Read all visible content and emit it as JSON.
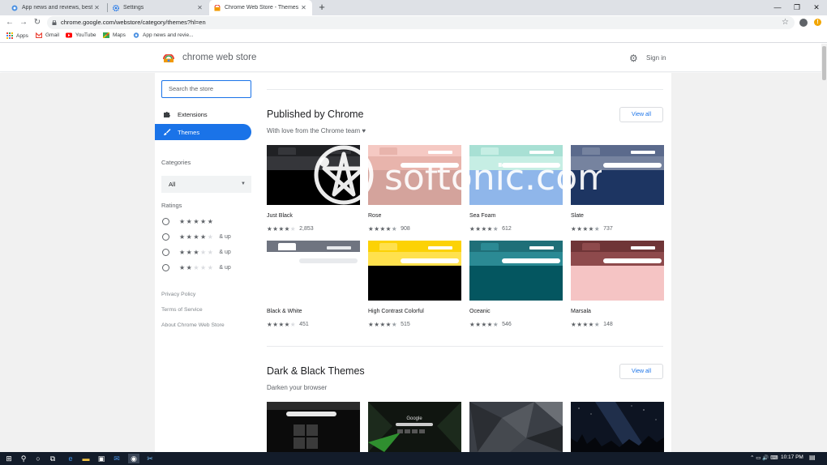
{
  "browser": {
    "tabs": [
      {
        "label": "App news and reviews, best soft",
        "active": false
      },
      {
        "label": "Settings",
        "active": false
      },
      {
        "label": "Chrome Web Store - Themes",
        "active": true
      }
    ],
    "url": "chrome.google.com/webstore/category/themes?hl=en",
    "bookmarks": [
      "Apps",
      "Gmail",
      "YouTube",
      "Maps",
      "App news and revie..."
    ]
  },
  "store": {
    "name": "chrome web store",
    "signin": "Sign in"
  },
  "sidebar": {
    "search_placeholder": "Search the store",
    "nav": [
      "Extensions",
      "Themes"
    ],
    "categories_label": "Categories",
    "category_value": "All",
    "ratings_label": "Ratings",
    "ratings": [
      {
        "stars": 5,
        "suffix": ""
      },
      {
        "stars": 4,
        "suffix": "& up"
      },
      {
        "stars": 3,
        "suffix": "& up"
      },
      {
        "stars": 2,
        "suffix": "& up"
      }
    ],
    "links": [
      "Privacy Policy",
      "Terms of Service",
      "About Chrome Web Store"
    ]
  },
  "sections": [
    {
      "title": "Published by Chrome",
      "subtitle": "With love from the Chrome team ♥",
      "view_all": "View all",
      "themes": [
        {
          "name": "Just Black",
          "rating": 4,
          "count": "2,853",
          "bar": "#202124",
          "tab": "#35363a",
          "body": "#000000",
          "omni": "#35363a"
        },
        {
          "name": "Rose",
          "rating": 4.5,
          "count": "908",
          "bar": "#f5c9c3",
          "tab": "#e8b4ac",
          "body": "#d4a39c",
          "omni": "#ffffff"
        },
        {
          "name": "Sea Foam",
          "rating": 4.5,
          "count": "612",
          "bar": "#a8e0d4",
          "tab": "#c6eee4",
          "body": "#8fb6ea",
          "omni": "#ffffff"
        },
        {
          "name": "Slate",
          "rating": 4.5,
          "count": "737",
          "bar": "#5b6a8c",
          "tab": "#76839f",
          "body": "#1d3562",
          "omni": "#ffffff"
        },
        {
          "name": "Black & White",
          "rating": 4,
          "count": "451",
          "bar": "#6f7480",
          "tab": "#ffffff",
          "body": "#ffffff",
          "omni": "#e8eaed"
        },
        {
          "name": "High Contrast Colorful",
          "rating": 4.5,
          "count": "515",
          "bar": "#fcd205",
          "tab": "#ffe14d",
          "body": "#000000",
          "omni": "#ffffff"
        },
        {
          "name": "Oceanic",
          "rating": 4.5,
          "count": "546",
          "bar": "#1f6f78",
          "tab": "#2b8a94",
          "body": "#045660",
          "omni": "#ffffff"
        },
        {
          "name": "Marsala",
          "rating": 4.5,
          "count": "148",
          "bar": "#6f3537",
          "tab": "#8e4a4c",
          "body": "#f5c4c4",
          "omni": "#ffffff"
        }
      ]
    },
    {
      "title": "Dark & Black Themes",
      "subtitle": "Darken your browser",
      "view_all": "View all",
      "thumbs": [
        "#0b0b0b",
        "#101510",
        "#3b3f46",
        "#0d1422"
      ]
    }
  ],
  "watermark": "softonic.com",
  "taskbar": {
    "time": "10:17 PM"
  },
  "colors": {
    "accent": "#1a73e8",
    "page_bg": "#f1f1f1"
  }
}
